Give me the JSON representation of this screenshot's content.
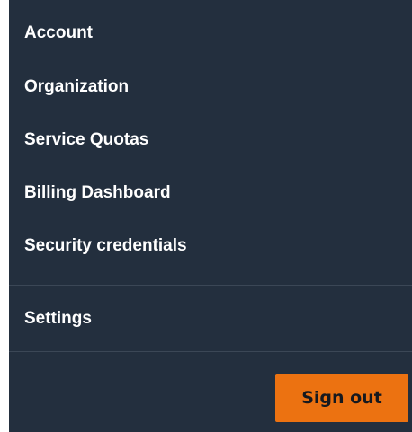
{
  "menu": {
    "items": [
      {
        "label": "Account"
      },
      {
        "label": "Organization"
      },
      {
        "label": "Service Quotas"
      },
      {
        "label": "Billing Dashboard"
      },
      {
        "label": "Security credentials"
      }
    ],
    "settings_label": "Settings",
    "signout_label": "Sign out"
  },
  "colors": {
    "background": "#232f3e",
    "divider": "#3b4756",
    "button": "#ec7211",
    "text": "#ffffff"
  }
}
